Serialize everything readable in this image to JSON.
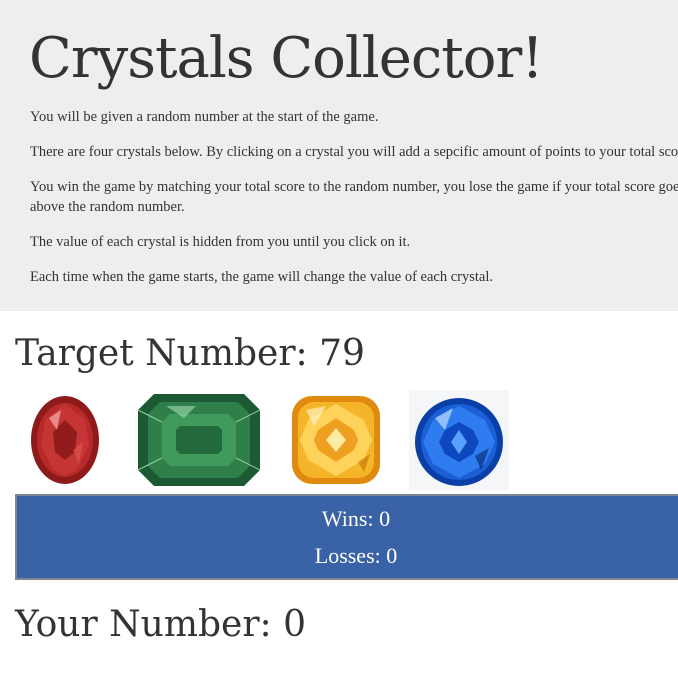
{
  "header": {
    "title": "Crystals Collector!",
    "rules": [
      "You will be given a random number at the start of the game.",
      "There are four crystals below. By clicking on a crystal you will add a sepcific amount of points to your total score.",
      "You win the game by matching your total score to the random number, you lose the game if your total score goes above the random number.",
      "The value of each crystal is hidden from you until you click on it.",
      "Each time when the game starts, the game will change the value of each crystal."
    ]
  },
  "target": {
    "label": "Target Number: 79"
  },
  "crystals": [
    {
      "icon": "red-crystal-icon",
      "color": "#b22a2a"
    },
    {
      "icon": "green-crystal-icon",
      "color": "#2f7f4a"
    },
    {
      "icon": "yellow-crystal-icon",
      "color": "#f2a91e"
    },
    {
      "icon": "blue-crystal-icon",
      "color": "#1a5fd6"
    }
  ],
  "score": {
    "wins": "Wins: 0",
    "losses": "Losses: 0",
    "panel_color": "#3a62a7"
  },
  "player": {
    "label": "Your Number: 0"
  }
}
